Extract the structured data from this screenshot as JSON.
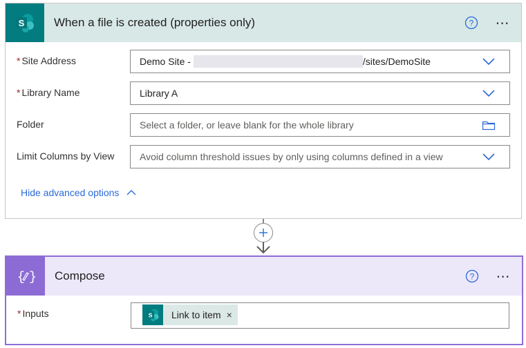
{
  "trigger": {
    "title": "When a file is created (properties only)",
    "fields": [
      {
        "label": "Site Address",
        "required": true,
        "value_prefix": "Demo Site -",
        "value_suffix": "/sites/DemoSite",
        "trailing_icon": "chevron-down-icon"
      },
      {
        "label": "Library Name",
        "required": true,
        "value": "Library A",
        "trailing_icon": "chevron-down-icon"
      },
      {
        "label": "Folder",
        "required": false,
        "placeholder": "Select a folder, or leave blank for the whole library",
        "trailing_icon": "folder-icon"
      },
      {
        "label": "Limit Columns by View",
        "required": false,
        "placeholder": "Avoid column threshold issues by only using columns defined in a view",
        "trailing_icon": "chevron-down-icon"
      }
    ],
    "advanced_link": "Hide advanced options",
    "required_mark": "*",
    "header_color": "#d8e8e6",
    "icon_color": "#037c7f"
  },
  "compose": {
    "title": "Compose",
    "inputs_label": "Inputs",
    "required_mark": "*",
    "token_label": "Link to item",
    "token_close": "×",
    "header_color": "#ede7fa",
    "icon_color": "#8c6cd4",
    "border_color": "#8e6ed8"
  },
  "icons": {
    "more": "⋯",
    "help": "question-circle-icon"
  },
  "accent": "#2b6ad8"
}
